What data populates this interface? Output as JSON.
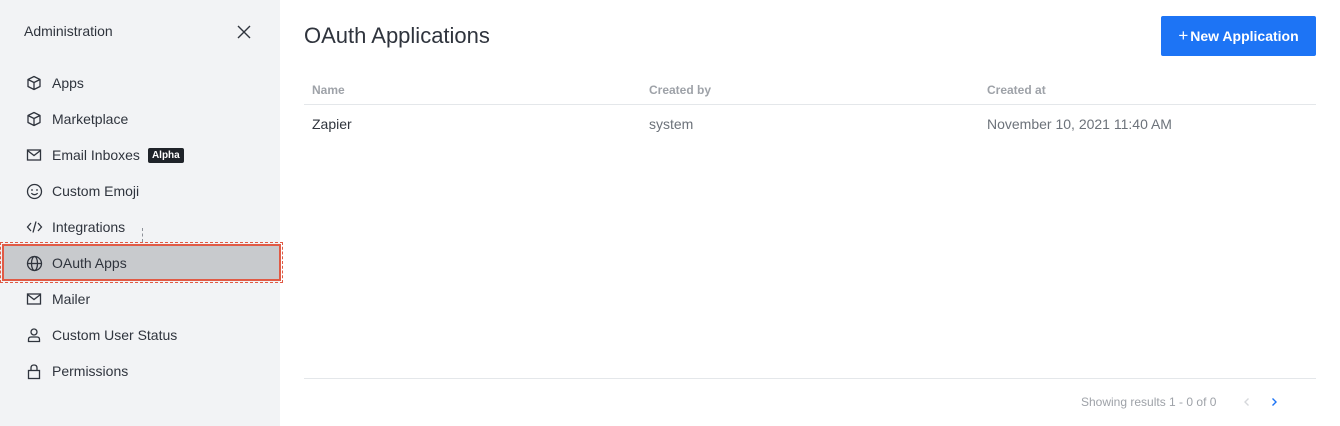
{
  "sidebar": {
    "title": "Administration",
    "items": [
      {
        "label": "Apps",
        "icon": "cube-icon"
      },
      {
        "label": "Marketplace",
        "icon": "cube-icon"
      },
      {
        "label": "Email Inboxes",
        "icon": "mail-icon",
        "badge": "Alpha"
      },
      {
        "label": "Custom Emoji",
        "icon": "emoji-icon"
      },
      {
        "label": "Integrations",
        "icon": "code-icon"
      },
      {
        "label": "OAuth Apps",
        "icon": "globe-icon",
        "active": true
      },
      {
        "label": "Mailer",
        "icon": "mail-icon"
      },
      {
        "label": "Custom User Status",
        "icon": "user-icon"
      },
      {
        "label": "Permissions",
        "icon": "lock-icon"
      }
    ]
  },
  "main": {
    "title": "OAuth Applications",
    "new_button": {
      "plus": "+",
      "label": "New Application"
    },
    "table": {
      "headers": [
        "Name",
        "Created by",
        "Created at"
      ],
      "rows": [
        {
          "name": "Zapier",
          "created_by": "system",
          "created_at": "November 10, 2021 11:40 AM"
        }
      ]
    },
    "pagination": {
      "text": "Showing results 1 - 0 of 0"
    }
  },
  "colors": {
    "accent": "#1d74f5",
    "sidebar_bg": "#f2f3f5",
    "active_item_bg": "#c8cacd",
    "highlight_border": "#e05a45"
  }
}
